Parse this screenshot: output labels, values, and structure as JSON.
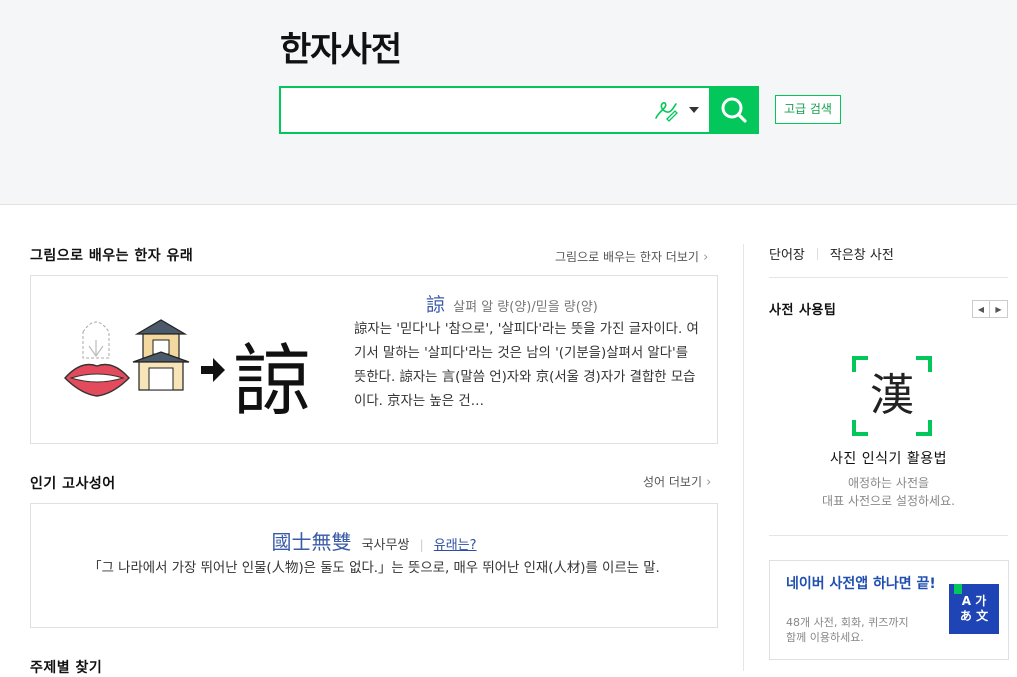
{
  "header": {
    "logo": "한자사전",
    "search": {
      "value": "",
      "placeholder": ""
    },
    "advanced_search_label": "고급 검색"
  },
  "origin_section": {
    "title": "그림으로 배우는 한자 유래",
    "more": "그림으로 배우는 한자 더보기",
    "hanja": "諒",
    "reading": "살펴 알 량(양)/믿을 량(양)",
    "description": "諒자는 '믿다'나 '참으로', '살피다'라는 뜻을 가진 글자이다. 여기서 말하는 '살피다'라는 것은 남의 '(기분을)살펴서 알다'를 뜻한다. 諒자는 言(말씀 언)자와 京(서울 경)자가 결합한 모습이다. 京자는 높은 건…",
    "image_glyph": "諒"
  },
  "idiom_section": {
    "title": "인기 고사성어",
    "more": "성어 더보기",
    "hanja": "國士無雙",
    "reading": "국사무쌍",
    "origin_link": "유래는?",
    "meaning": "「그 나라에서 가장 뛰어난 인물(人物)은 둘도 없다.」는 뜻으로, 매우 뛰어난 인재(人材)를 이르는 말."
  },
  "theme_section": {
    "title": "주제별 찾기"
  },
  "sidebar": {
    "tabs": [
      "단어장",
      "작은창 사전"
    ],
    "tip": {
      "title": "사전 사용팁",
      "icon_glyph": "漢",
      "name": "사진 인식기 활용법",
      "desc_line1": "애정하는 사전을",
      "desc_line2": "대표 사전으로 설정하세요."
    },
    "app": {
      "title": "네이버 사전앱 하나면 끝!",
      "desc_line1": "48개 사전, 회화, 퀴즈까지",
      "desc_line2": "함께 이용하세요.",
      "icon_line1": "A 가",
      "icon_line2": "あ 文"
    }
  },
  "colors": {
    "accent": "#03c75a",
    "hanja_blue": "#3a5ba8",
    "app_blue": "#1e44b5"
  },
  "icons": [
    "handwriting-icon",
    "dropdown-icon",
    "search-icon",
    "prev-arrow-icon",
    "next-arrow-icon",
    "camera-frame-icon",
    "bookmark-icon"
  ]
}
